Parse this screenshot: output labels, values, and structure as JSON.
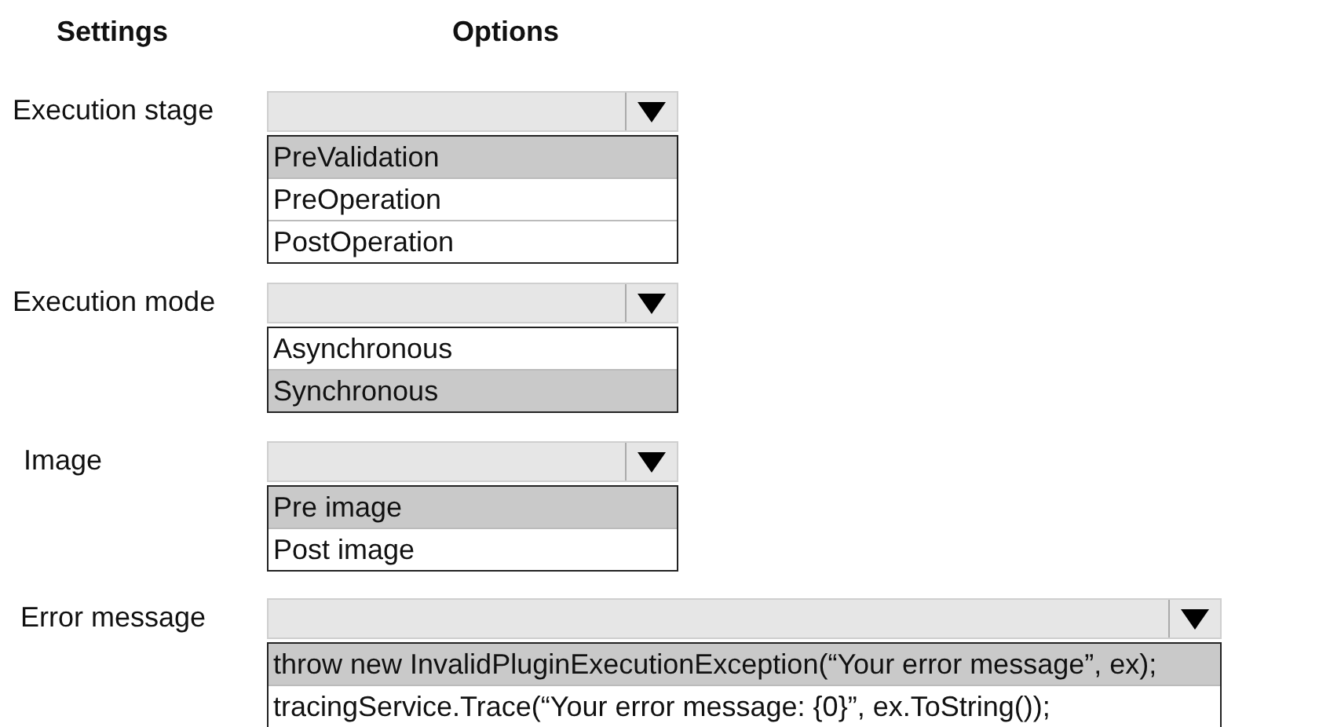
{
  "headers": {
    "settings": "Settings",
    "options": "Options"
  },
  "settings": [
    {
      "label": "Execution stage",
      "options": [
        {
          "text": "PreValidation",
          "selected": true
        },
        {
          "text": "PreOperation",
          "selected": false
        },
        {
          "text": "PostOperation",
          "selected": false
        }
      ]
    },
    {
      "label": "Execution mode",
      "options": [
        {
          "text": "Asynchronous",
          "selected": false
        },
        {
          "text": "Synchronous",
          "selected": true
        }
      ]
    },
    {
      "label": "Image",
      "options": [
        {
          "text": "Pre image",
          "selected": true
        },
        {
          "text": "Post image",
          "selected": false
        }
      ]
    },
    {
      "label": "Error message",
      "options": [
        {
          "text": "throw new InvalidPluginExecutionException(“Your error message”, ex);",
          "selected": true
        },
        {
          "text": "tracingService.Trace(“Your error message: {0}”, ex.ToString());",
          "selected": false
        }
      ]
    }
  ]
}
